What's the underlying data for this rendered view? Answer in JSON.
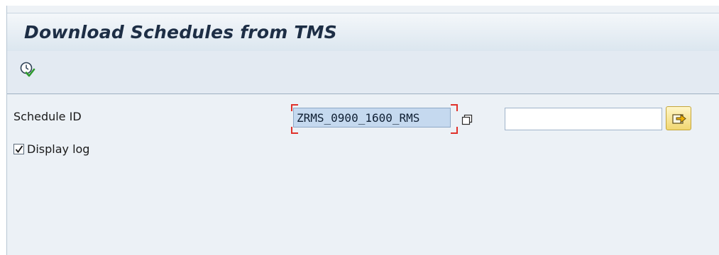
{
  "screen": {
    "title": "Download Schedules from TMS"
  },
  "toolbar": {
    "execute_icon": "execute-clock-icon"
  },
  "form": {
    "schedule_id": {
      "label": "Schedule ID",
      "value": "ZRMS_0900_1600_RMS",
      "to_value": "",
      "multiple_selection_icon": "multiple-selection-icon",
      "select_icon": "arrow-select-icon"
    },
    "display_log": {
      "label": "Display log",
      "checked": true
    }
  },
  "colors": {
    "title_text": "#1d2e45",
    "highlight_field": "#c5d9ef",
    "required_marker": "#e0312a",
    "select_button": "#f1d771"
  }
}
